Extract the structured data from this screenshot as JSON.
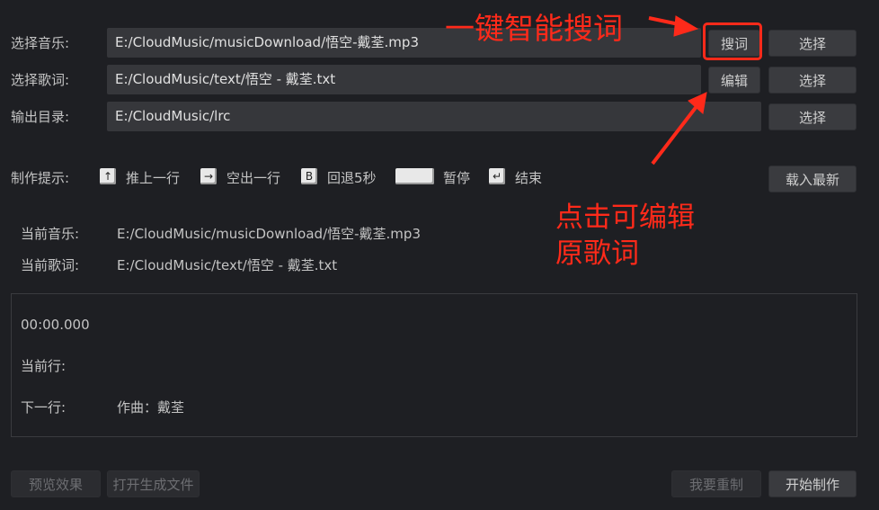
{
  "rows": {
    "music": {
      "label": "选择音乐:",
      "value": "E:/CloudMusic/musicDownload/悟空-戴荃.mp3",
      "search_label": "搜词",
      "choose_label": "选择"
    },
    "lyrics": {
      "label": "选择歌词:",
      "value": "E:/CloudMusic/text/悟空 - 戴荃.txt",
      "edit_label": "编辑",
      "choose_label": "选择"
    },
    "output": {
      "label": "输出目录:",
      "value": "E:/CloudMusic/lrc",
      "choose_label": "选择"
    }
  },
  "tips": {
    "label": "制作提示:",
    "items": [
      {
        "key": "↑",
        "text": "推上一行"
      },
      {
        "key": "→",
        "text": "空出一行"
      },
      {
        "key": "B",
        "text": "回退5秒"
      },
      {
        "key": "",
        "text": "暂停"
      },
      {
        "key": "↵",
        "text": "结束"
      }
    ],
    "reload_label": "载入最新"
  },
  "current": {
    "music_label": "当前音乐:",
    "music_value": "E:/CloudMusic/musicDownload/悟空-戴荃.mp3",
    "lyrics_label": "当前歌词:",
    "lyrics_value": "E:/CloudMusic/text/悟空 - 戴荃.txt"
  },
  "panel": {
    "time": "00:00.000",
    "current_line_label": "当前行:",
    "current_line_value": "",
    "next_line_label": "下一行:",
    "next_line_value": "作曲：戴荃"
  },
  "bottom": {
    "preview_label": "预览效果",
    "open_file_label": "打开生成文件",
    "redo_label": "我要重制",
    "start_label": "开始制作"
  },
  "annotations": {
    "search_note": "一键智能搜词",
    "edit_note_line1": "点击可编辑",
    "edit_note_line2": "原歌词"
  },
  "colors": {
    "background": "#1e1f23",
    "field": "#36373b",
    "annotation_red": "#ff2a1a"
  }
}
